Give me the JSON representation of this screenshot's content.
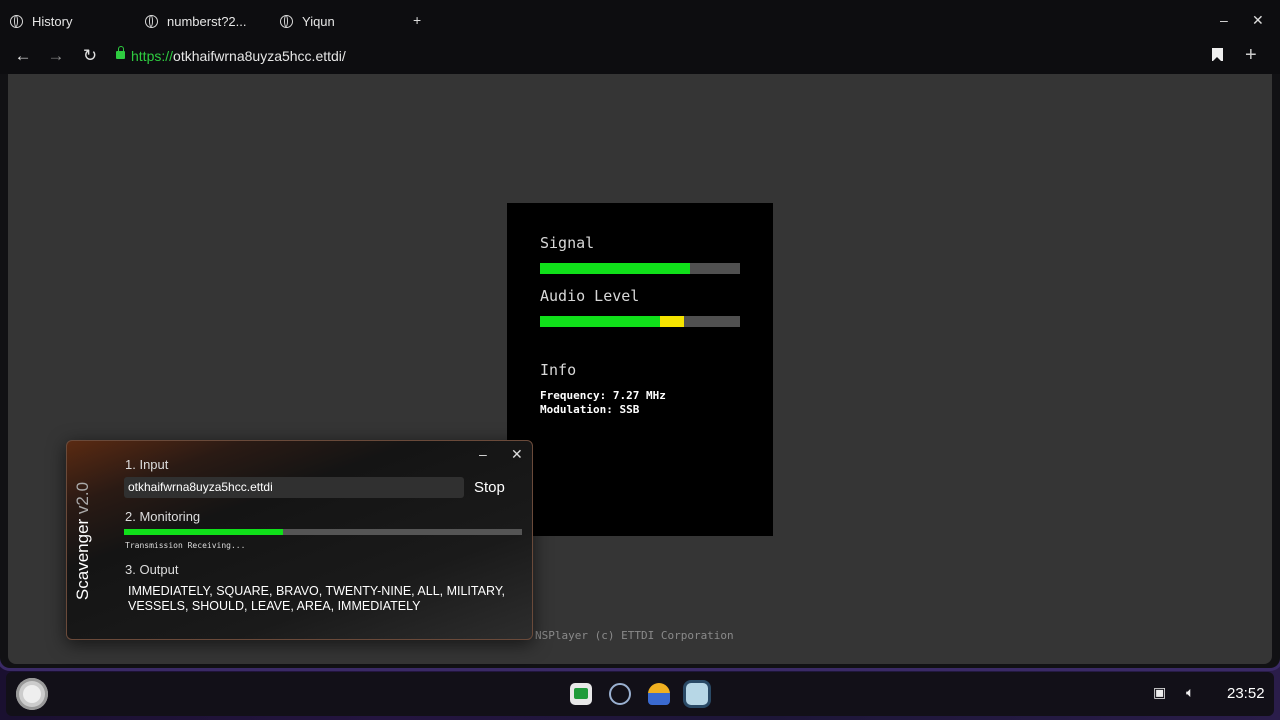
{
  "browser": {
    "tabs": [
      {
        "label": "History"
      },
      {
        "label": "numberst?2..."
      },
      {
        "label": "Yiqun"
      }
    ],
    "new_tab": "+",
    "minimize": "–",
    "close": "✕",
    "url_proto": "https://",
    "url_host": "otkhaifwrna8uyza5hcc.ettdi/"
  },
  "player": {
    "signal_label": "Signal",
    "signal_level": 0.75,
    "audio_label": "Audio Level",
    "audio_green_level": 0.6,
    "audio_yellow_level": 0.12,
    "info_heading": "Info",
    "frequency_line": "Frequency: 7.27 MHz",
    "modulation_line": "Modulation: SSB",
    "footer": "NSPlayer (c) ETTDI Corporation",
    "colors": {
      "green": "#10e01a",
      "yellow": "#f5e400",
      "track": "#505050"
    }
  },
  "scavenger": {
    "app_name": "Scavenger",
    "version": "v2.0",
    "minimize": "–",
    "close": "✕",
    "step1_label": "1. Input",
    "input_value": "otkhaifwrna8uyza5hcc.ettdi",
    "stop_button": "Stop",
    "step2_label": "2. Monitoring",
    "monitor_progress": 0.4,
    "status_text": "Transmission Receiving...",
    "step3_label": "3. Output",
    "output_text": "IMMEDIATELY, SQUARE, BRAVO, TWENTY-NINE, ALL, MILITARY, VESSELS, SHOULD, LEAVE, AREA, IMMEDIATELY"
  },
  "taskbar": {
    "apps": [
      "terminal-icon",
      "chromium-icon",
      "files-icon",
      "app-window-icon"
    ],
    "time": "23:52"
  }
}
